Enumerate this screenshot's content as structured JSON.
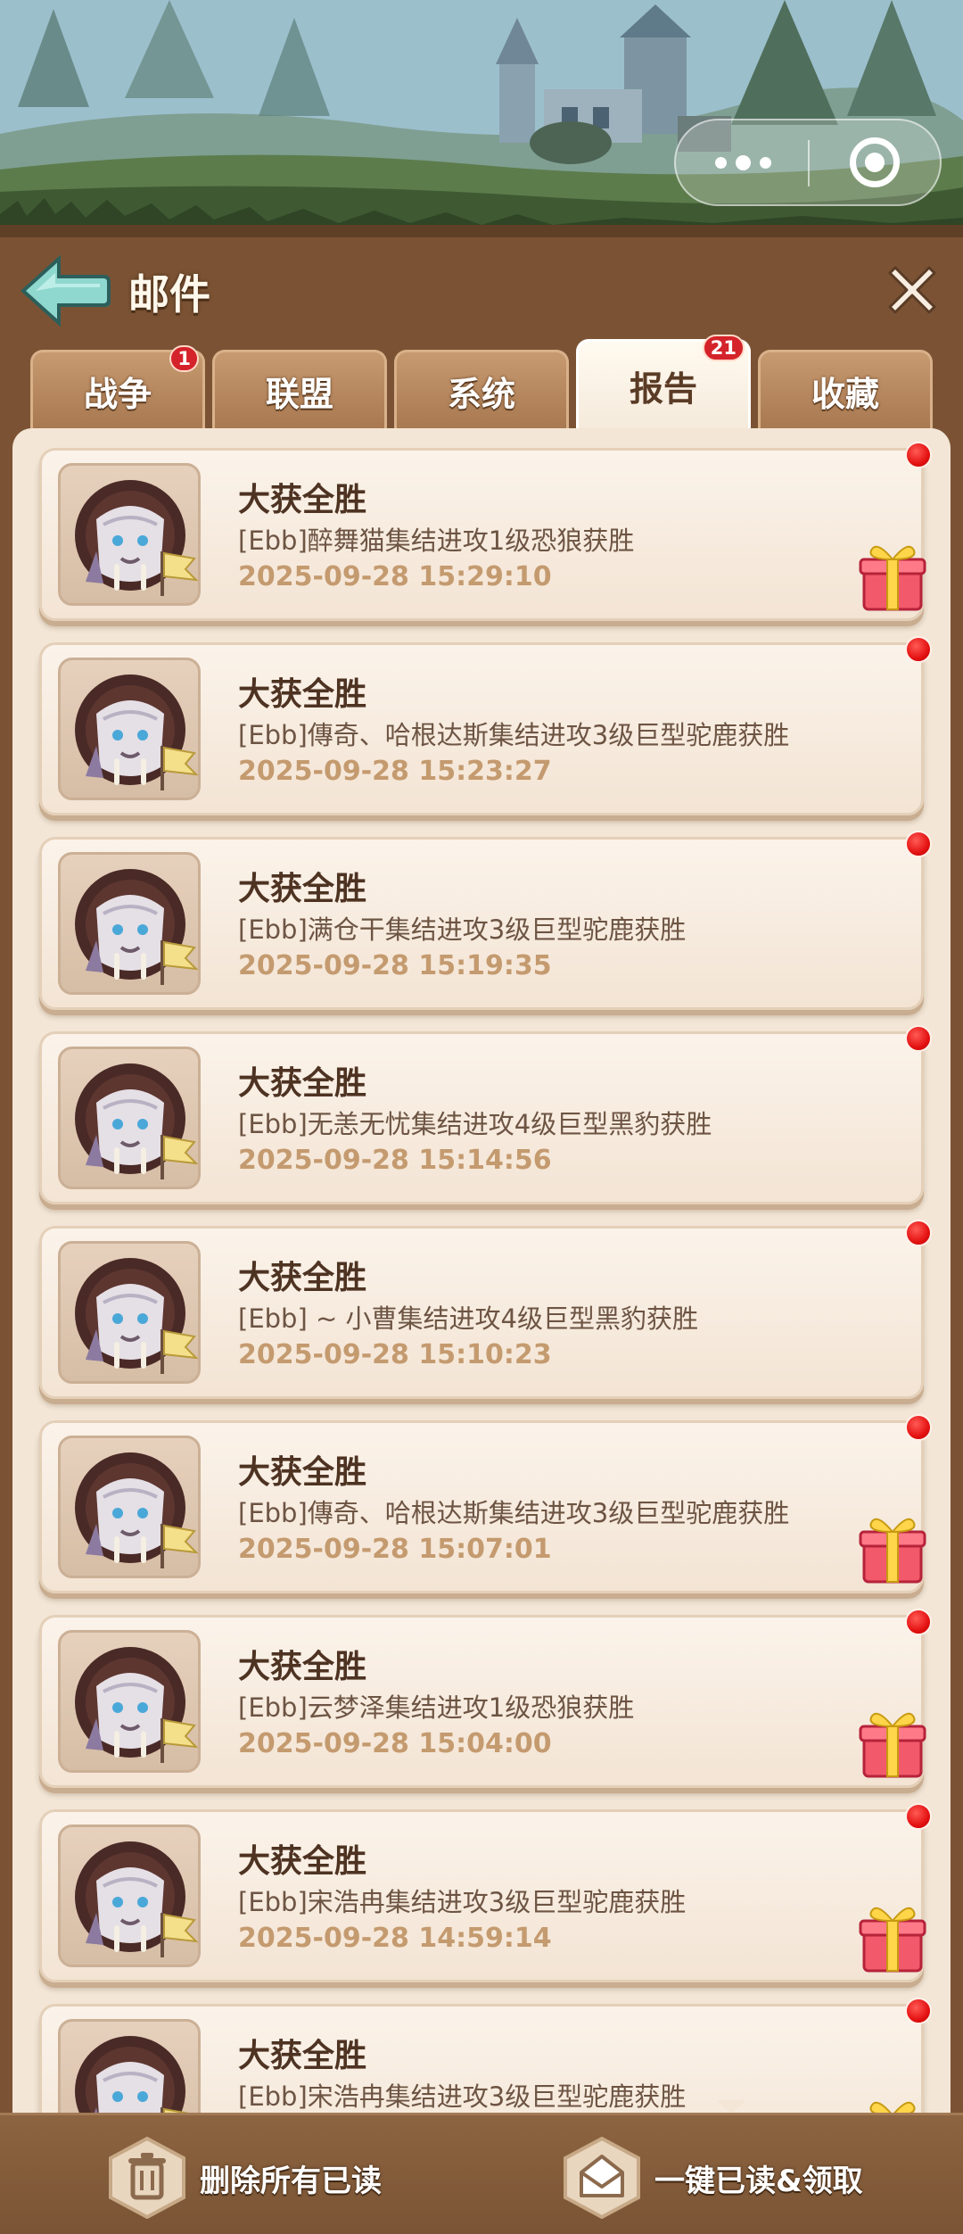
{
  "capsule": {
    "more_icon": "more-dots-icon",
    "close_icon": "target-circle-icon"
  },
  "header": {
    "title": "邮件",
    "back_icon": "back-arrow-icon",
    "close_icon": "close-x-icon"
  },
  "tabs": [
    {
      "label": "战争",
      "badge": "1",
      "active": false
    },
    {
      "label": "联盟",
      "badge": "",
      "active": false
    },
    {
      "label": "系统",
      "badge": "",
      "active": false
    },
    {
      "label": "报告",
      "badge": "21",
      "active": true
    },
    {
      "label": "收藏",
      "badge": "",
      "active": false
    }
  ],
  "reports": [
    {
      "title": "大获全胜",
      "desc": "[Ebb]醉舞猫集结进攻1级恐狼获胜",
      "time": "2025-09-28 15:29:10",
      "gift": true,
      "unread": true
    },
    {
      "title": "大获全胜",
      "desc": "[Ebb]傳奇、哈根达斯集结进攻3级巨型驼鹿获胜",
      "time": "2025-09-28 15:23:27",
      "gift": false,
      "unread": true
    },
    {
      "title": "大获全胜",
      "desc": "[Ebb]满仓干集结进攻3级巨型驼鹿获胜",
      "time": "2025-09-28 15:19:35",
      "gift": false,
      "unread": true
    },
    {
      "title": "大获全胜",
      "desc": "[Ebb]无恙无忧集结进攻4级巨型黑豹获胜",
      "time": "2025-09-28 15:14:56",
      "gift": false,
      "unread": true
    },
    {
      "title": "大获全胜",
      "desc": "[Ebb] ~ 小曹集结进攻4级巨型黑豹获胜",
      "time": "2025-09-28 15:10:23",
      "gift": false,
      "unread": true
    },
    {
      "title": "大获全胜",
      "desc": "[Ebb]傳奇、哈根达斯集结进攻3级巨型驼鹿获胜",
      "time": "2025-09-28 15:07:01",
      "gift": true,
      "unread": true
    },
    {
      "title": "大获全胜",
      "desc": "[Ebb]云梦泽集结进攻1级恐狼获胜",
      "time": "2025-09-28 15:04:00",
      "gift": true,
      "unread": true
    },
    {
      "title": "大获全胜",
      "desc": "[Ebb]宋浩冉集结进攻3级巨型驼鹿获胜",
      "time": "2025-09-28 14:59:14",
      "gift": true,
      "unread": true
    },
    {
      "title": "大获全胜",
      "desc": "[Ebb]宋浩冉集结进攻3级巨型驼鹿获胜",
      "time": "",
      "gift": true,
      "unread": true
    }
  ],
  "bottom": {
    "delete_label": "删除所有已读",
    "delete_icon": "trash-icon",
    "read_claim_label": "一键已读&领取",
    "read_claim_icon": "envelope-icon"
  },
  "colors": {
    "unread_dot": "#e41212",
    "time_text": "#c49a6f",
    "panel": "#7b5334",
    "list_bg": "#f3e6d6"
  }
}
